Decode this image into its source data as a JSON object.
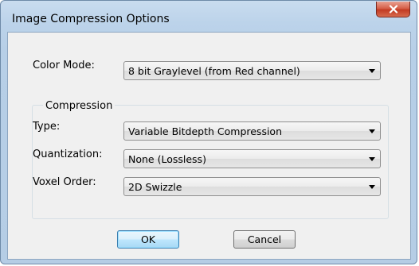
{
  "window": {
    "title": "Image Compression Options"
  },
  "color_mode": {
    "label": "Color Mode:",
    "value": "8 bit Graylevel (from Red channel)"
  },
  "compression": {
    "group_label": "Compression",
    "type": {
      "label": "Type:",
      "value": "Variable Bitdepth Compression"
    },
    "quantization": {
      "label": "Quantization:",
      "value": "None (Lossless)"
    },
    "voxel_order": {
      "label": "Voxel Order:",
      "value": "2D Swizzle"
    }
  },
  "buttons": {
    "ok_label": "OK",
    "cancel_label": "Cancel"
  },
  "colors": {
    "close_button": "#c23a22",
    "default_button_border": "#3c7fb1",
    "dialog_background": "#f0f0f0"
  }
}
